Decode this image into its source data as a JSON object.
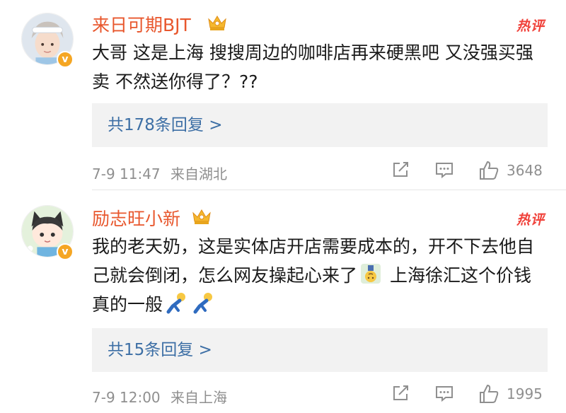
{
  "comments": [
    {
      "username": "来日可期BJT",
      "hot_label": "热评",
      "text": "大哥 这是上海 搜搜周边的咖啡店再来硬黑吧 又没强买强卖 不然送你得了？??",
      "replies_label": "共178条回复 >",
      "date": "7-9 11:47",
      "location": "来自湖北",
      "likes": "3648",
      "badge": "v"
    },
    {
      "username": "励志旺小新",
      "hot_label": "热评",
      "text_part1": "我的老天奶，这是实体店开店需要成本的，开不下去他自己就会倒闭，怎么网友操起心来了",
      "text_part2": " 上海徐汇这个价钱真的一般",
      "replies_label": "共15条回复 >",
      "date": "7-9 12:00",
      "location": "来自上海",
      "likes": "1995",
      "badge": "v"
    }
  ],
  "colors": {
    "username": "#e8572d",
    "hot": "#f0413a",
    "link": "#3d6fa5",
    "meta": "#8f8f8f"
  },
  "icons": [
    "share-icon",
    "comment-icon",
    "like-icon",
    "crown-icon",
    "verified-badge"
  ]
}
